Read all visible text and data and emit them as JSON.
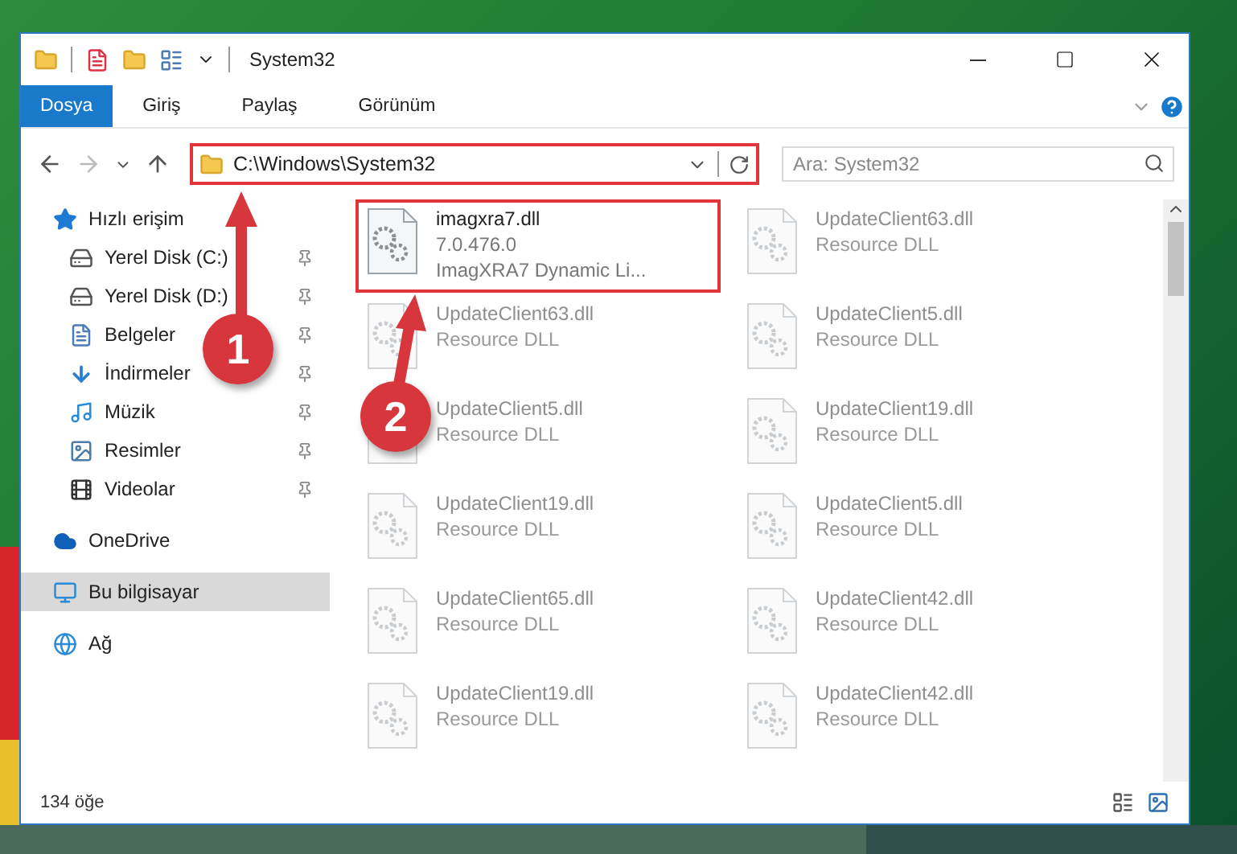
{
  "window": {
    "title": "System32"
  },
  "ribbon_tabs": [
    {
      "label": "Dosya",
      "selected": true
    },
    {
      "label": "Giriş",
      "selected": false
    },
    {
      "label": "Paylaş",
      "selected": false
    },
    {
      "label": "Görünüm",
      "selected": false
    }
  ],
  "address": {
    "value": "C:\\Windows\\System32",
    "highlighted": true
  },
  "search": {
    "placeholder": "Ara: System32"
  },
  "sidebar": {
    "items": [
      {
        "kind": "quick",
        "label": "Hızlı erişim",
        "selected": false,
        "pinned": false
      },
      {
        "kind": "disk-c",
        "label": "Yerel Disk (C:)",
        "selected": false,
        "pinned": true
      },
      {
        "kind": "disk",
        "label": "Yerel Disk (D:)",
        "selected": false,
        "pinned": true
      },
      {
        "kind": "documents",
        "label": "Belgeler",
        "selected": false,
        "pinned": true
      },
      {
        "kind": "downloads",
        "label": "İndirmeler",
        "selected": false,
        "pinned": true
      },
      {
        "kind": "music",
        "label": "Müzik",
        "selected": false,
        "pinned": true
      },
      {
        "kind": "pictures",
        "label": "Resimler",
        "selected": false,
        "pinned": true
      },
      {
        "kind": "videos",
        "label": "Videolar",
        "selected": false,
        "pinned": true
      },
      {
        "kind": "onedrive",
        "label": "OneDrive",
        "selected": false,
        "pinned": false
      },
      {
        "kind": "computer",
        "label": "Bu bilgisayar",
        "selected": true,
        "pinned": false
      },
      {
        "kind": "network",
        "label": "Ağ",
        "selected": false,
        "pinned": false
      }
    ]
  },
  "files": [
    {
      "name": "imagxra7.dll",
      "version": "7.0.476.0",
      "description": "ImagXRA7 Dynamic Li...",
      "highlighted": true,
      "blurred": false
    },
    {
      "name": "UpdateClient63.dll",
      "description": "Resource DLL",
      "highlighted": false,
      "blurred": true
    },
    {
      "name": "UpdateClient63.dll",
      "description": "Resource DLL",
      "highlighted": false,
      "blurred": true
    },
    {
      "name": "UpdateClient5.dll",
      "description": "Resource DLL",
      "highlighted": false,
      "blurred": true
    },
    {
      "name": "UpdateClient5.dll",
      "description": "Resource DLL",
      "highlighted": false,
      "blurred": true
    },
    {
      "name": "UpdateClient19.dll",
      "description": "Resource DLL",
      "highlighted": false,
      "blurred": true
    },
    {
      "name": "UpdateClient19.dll",
      "description": "Resource DLL",
      "highlighted": false,
      "blurred": true
    },
    {
      "name": "UpdateClient5.dll",
      "description": "Resource DLL",
      "highlighted": false,
      "blurred": true
    },
    {
      "name": "UpdateClient65.dll",
      "description": "Resource DLL",
      "highlighted": false,
      "blurred": true
    },
    {
      "name": "UpdateClient42.dll",
      "description": "Resource DLL",
      "highlighted": false,
      "blurred": true
    },
    {
      "name": "UpdateClient19.dll",
      "description": "Resource DLL",
      "highlighted": false,
      "blurred": true
    },
    {
      "name": "UpdateClient42.dll",
      "description": "Resource DLL",
      "highlighted": false,
      "blurred": true
    }
  ],
  "status_bar": {
    "count": "134 öğe"
  },
  "annotations": [
    {
      "number": "1"
    },
    {
      "number": "2"
    }
  ]
}
